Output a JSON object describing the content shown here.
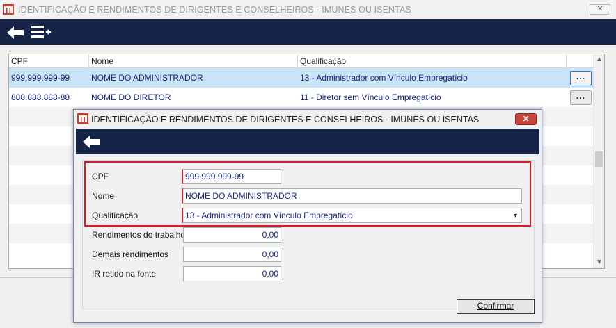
{
  "window": {
    "title": "IDENTIFICAÇÃO E RENDIMENTOS DE DIRIGENTES E CONSELHEIROS - IMUNES OU ISENTAS",
    "close_label": "✕"
  },
  "toolbar": {
    "back_icon": "arrow-left-icon",
    "add_row_icon": "list-add-icon"
  },
  "grid": {
    "columns": [
      "CPF",
      "Nome",
      "Qualificação"
    ],
    "rows": [
      {
        "cpf": "999.999.999-99",
        "nome": "NOME DO ADMINISTRADOR",
        "qualificacao": "13 - Administrador com Vínculo Empregatício",
        "action": "..."
      },
      {
        "cpf": "888.888.888-88",
        "nome": "NOME DO DIRETOR",
        "qualificacao": "11 - Diretor sem Vínculo Empregatício",
        "action": "..."
      }
    ]
  },
  "dialog": {
    "title": "IDENTIFICAÇÃO E RENDIMENTOS DE DIRIGENTES E CONSELHEIROS - IMUNES OU ISENTAS",
    "close_label": "✕",
    "fields": {
      "cpf": {
        "label": "CPF",
        "value": "999.999.999-99"
      },
      "nome": {
        "label": "Nome",
        "value": "NOME DO ADMINISTRADOR"
      },
      "qualificacao": {
        "label": "Qualificação",
        "value": "13 - Administrador com Vínculo Empregatício"
      },
      "rendimentos_trabalho": {
        "label": "Rendimentos do trabalho",
        "value": "0,00"
      },
      "demais_rendimentos": {
        "label": "Demais rendimentos",
        "value": "0,00"
      },
      "ir_retido": {
        "label": "IR retido na fonte",
        "value": "0,00"
      }
    },
    "confirm_label": "Confirmar"
  },
  "colors": {
    "toolbar_bg": "#162447",
    "selected_row": "#cce4f7",
    "highlight_border": "#e01820",
    "text_value": "#1a237e"
  }
}
